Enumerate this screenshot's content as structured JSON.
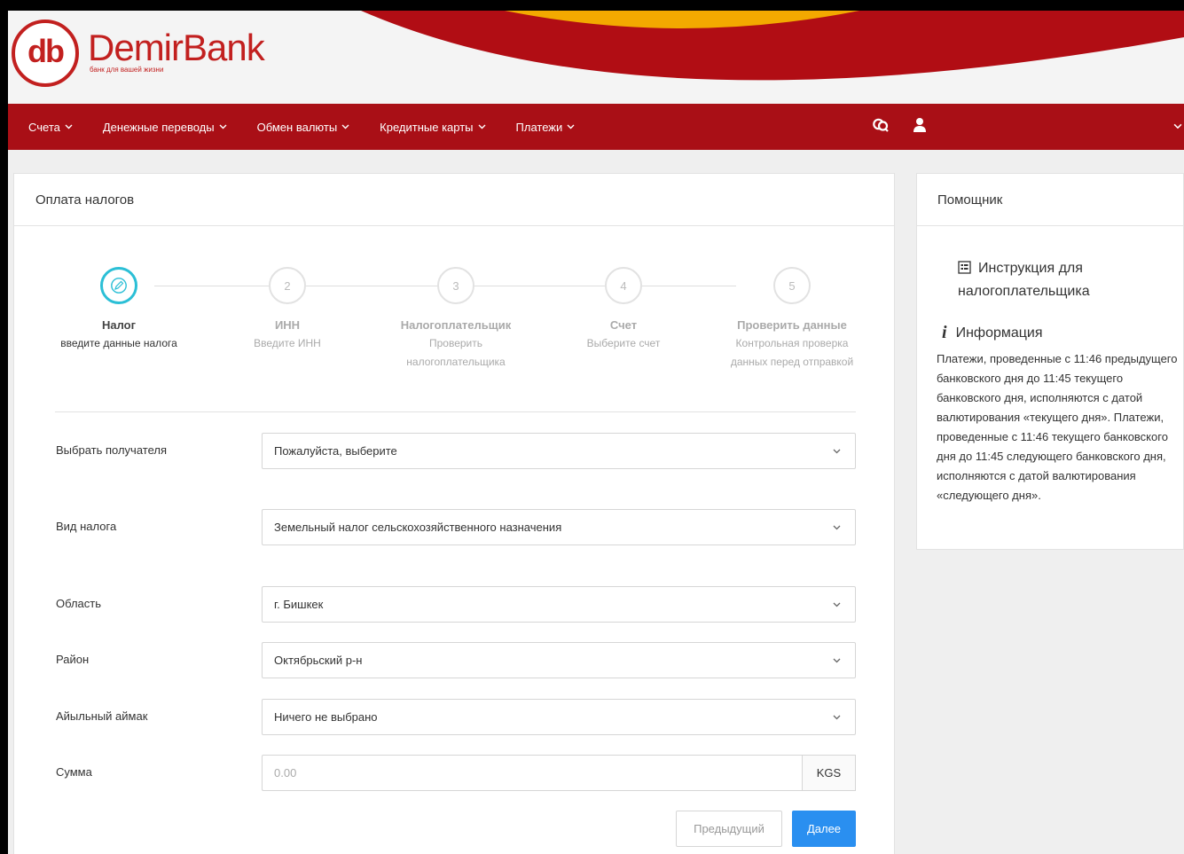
{
  "brand": {
    "logo_letters": "db",
    "name": "DemirBank",
    "tagline": "банк для вашей жизни"
  },
  "nav": {
    "items": [
      {
        "label": "Счета"
      },
      {
        "label": "Денежные переводы"
      },
      {
        "label": "Обмен валюты"
      },
      {
        "label": "Кредитные карты"
      },
      {
        "label": "Платежи"
      }
    ],
    "icons": [
      "chat-icon",
      "user-icon"
    ]
  },
  "main": {
    "title": "Оплата налогов",
    "steps": [
      {
        "number": "",
        "title": "Налог",
        "subtitle": "введите данные налога",
        "active": true,
        "icon": "pencil-icon"
      },
      {
        "number": "2",
        "title": "ИНН",
        "subtitle": "Введите ИНН",
        "active": false
      },
      {
        "number": "3",
        "title": "Налогоплательщик",
        "subtitle": "Проверить налогоплательщика",
        "active": false
      },
      {
        "number": "4",
        "title": "Счет",
        "subtitle": "Выберите счет",
        "active": false
      },
      {
        "number": "5",
        "title": "Проверить данные",
        "subtitle": "Контрольная проверка данных перед отправкой",
        "active": false
      }
    ],
    "form": {
      "recipient": {
        "label": "Выбрать получателя",
        "value": "Пожалуйста, выберите"
      },
      "tax_type": {
        "label": "Вид налога",
        "value": "Земельный налог сельскохозяйственного назначения"
      },
      "region": {
        "label": "Область",
        "value": "г. Бишкек"
      },
      "district": {
        "label": "Район",
        "value": "Октябрьский р-н"
      },
      "aimak": {
        "label": "Айыльный аймак",
        "value": "Ничего не выбрано"
      },
      "amount": {
        "label": "Сумма",
        "placeholder": "0.00",
        "currency": "KGS"
      }
    },
    "buttons": {
      "prev": "Предыдущий",
      "next": "Далее"
    }
  },
  "helper": {
    "title": "Помощник",
    "instruction_link": "Инструкция для налогоплательщика",
    "info_title": "Информация",
    "info_text": "Платежи, проведенные с 11:46 предыдущего банковского дня до 11:45 текущего банковского дня, исполняются с датой валютирования «текущего дня». Платежи, проведенные с 11:46 текущего банковского дня до 11:45 следующего банковского дня, исполняются с датой валютирования «следующего дня»."
  },
  "colors": {
    "brand_red": "#a90f16",
    "logo_red": "#c2201f",
    "accent_yellow": "#f3a900",
    "step_active": "#2bbfd6",
    "primary_button": "#2a8ff0"
  }
}
